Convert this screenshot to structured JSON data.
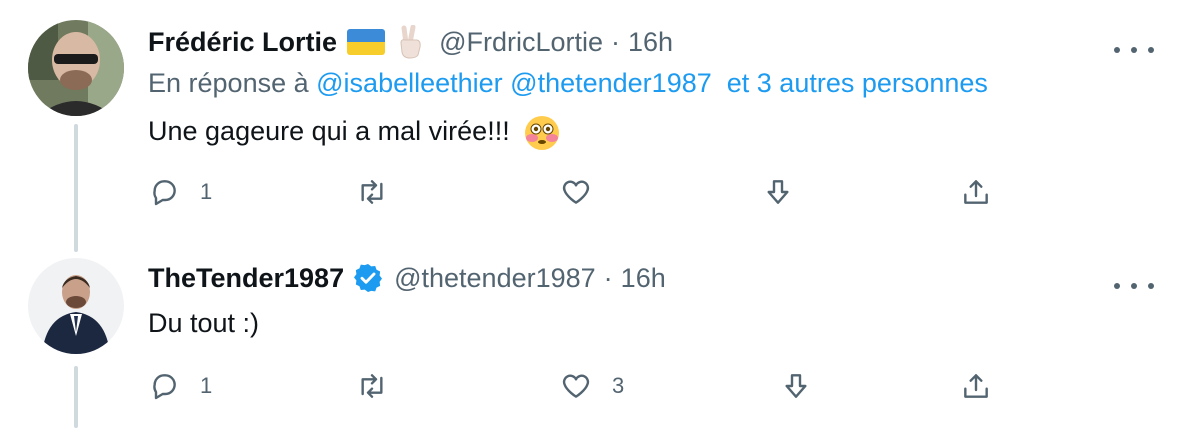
{
  "tweets": [
    {
      "author_name": "Frédéric Lortie",
      "handle": "@FrdricLortie",
      "separator": "·",
      "time": "16h",
      "reply_prefix": "En réponse à",
      "mentions": [
        "@isabelleethier",
        "@thetender1987"
      ],
      "others_text": "et 3 autres personnes",
      "text": "Une gageure qui a mal virée!!!",
      "reply_count": "1",
      "retweet_count": "",
      "like_count": "",
      "icons": [
        "ukraine-flag-icon",
        "victory-hand-icon",
        "flushed-face-icon"
      ]
    },
    {
      "author_name": "TheTender1987",
      "handle": "@thetender1987",
      "separator": "·",
      "time": "16h",
      "text": "Du tout :)",
      "reply_count": "1",
      "retweet_count": "",
      "like_count": "3",
      "icons": [
        "verified-badge-icon"
      ]
    }
  ],
  "colors": {
    "accent": "#1d9bf0",
    "secondary_text": "#536471",
    "thread_line": "#cfd9de"
  }
}
